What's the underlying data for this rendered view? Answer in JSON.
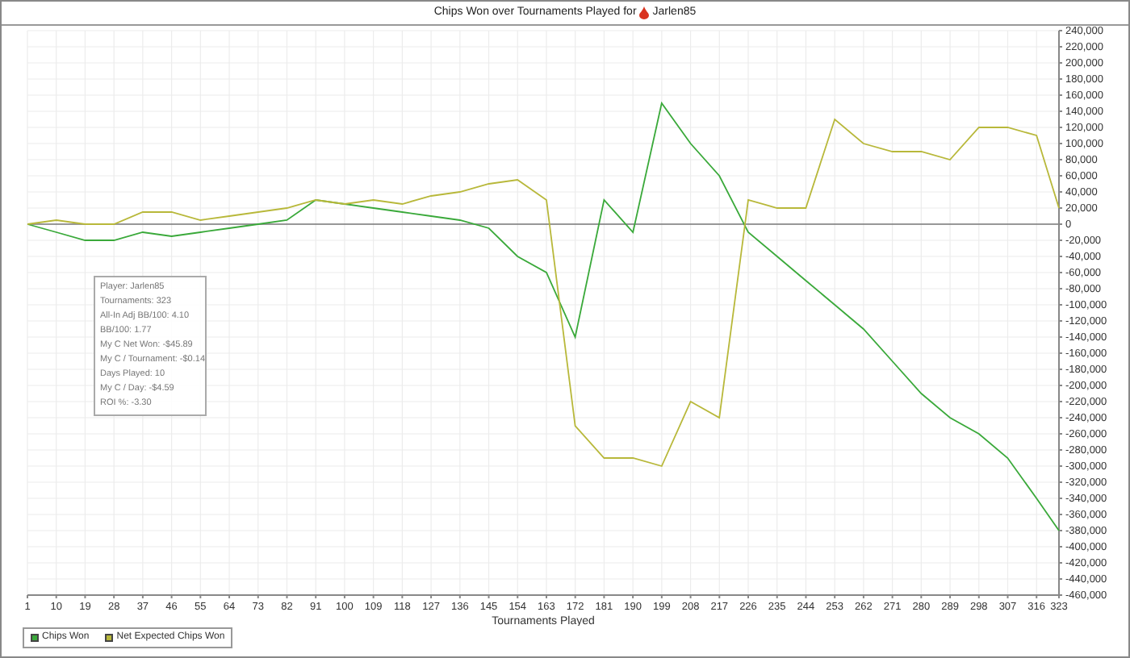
{
  "title": {
    "text": "Chips Won over Tournaments Played for",
    "player": "Jarlen85"
  },
  "stats": [
    "Player: Jarlen85",
    "Tournaments: 323",
    "All-In Adj BB/100: 4.10",
    "BB/100: 1.77",
    "My C Net Won: -$45.89",
    "My C / Tournament: -$0.14",
    "Days Played: 10",
    "My C / Day: -$4.59",
    "ROI %: -3.30"
  ],
  "chart_data": {
    "type": "line",
    "grid": true,
    "xlabel": "Tournaments Played",
    "x": [
      1,
      10,
      19,
      28,
      37,
      46,
      55,
      64,
      73,
      82,
      91,
      100,
      109,
      118,
      127,
      136,
      145,
      154,
      163,
      172,
      181,
      190,
      199,
      208,
      217,
      226,
      235,
      244,
      253,
      262,
      271,
      280,
      289,
      298,
      307,
      316,
      323
    ],
    "xticks": [
      1,
      10,
      19,
      28,
      37,
      46,
      55,
      64,
      73,
      82,
      91,
      100,
      109,
      118,
      127,
      136,
      145,
      154,
      163,
      172,
      181,
      190,
      199,
      208,
      217,
      226,
      235,
      244,
      253,
      262,
      271,
      280,
      289,
      298,
      307,
      316,
      323
    ],
    "xlim": [
      1,
      323
    ],
    "ylim": [
      -460000,
      240000
    ],
    "yticks": [
      {
        "value": 240000,
        "label": "240,000"
      },
      {
        "value": 220000,
        "label": "220,000"
      },
      {
        "value": 200000,
        "label": "200,000"
      },
      {
        "value": 180000,
        "label": "180,000"
      },
      {
        "value": 160000,
        "label": "160,000"
      },
      {
        "value": 140000,
        "label": "140,000"
      },
      {
        "value": 120000,
        "label": "120,000"
      },
      {
        "value": 100000,
        "label": "100,000"
      },
      {
        "value": 80000,
        "label": "80,000"
      },
      {
        "value": 60000,
        "label": "60,000"
      },
      {
        "value": 40000,
        "label": "40,000"
      },
      {
        "value": 20000,
        "label": "20,000"
      },
      {
        "value": 0,
        "label": "0"
      },
      {
        "value": -20000,
        "label": "-20,000"
      },
      {
        "value": -40000,
        "label": "-40,000"
      },
      {
        "value": -60000,
        "label": "-60,000"
      },
      {
        "value": -80000,
        "label": "-80,000"
      },
      {
        "value": -100000,
        "label": "-100,000"
      },
      {
        "value": -120000,
        "label": "-120,000"
      },
      {
        "value": -140000,
        "label": "-140,000"
      },
      {
        "value": -160000,
        "label": "-160,000"
      },
      {
        "value": -180000,
        "label": "-180,000"
      },
      {
        "value": -200000,
        "label": "-200,000"
      },
      {
        "value": -220000,
        "label": "-220,000"
      },
      {
        "value": -240000,
        "label": "-240,000"
      },
      {
        "value": -260000,
        "label": "-260,000"
      },
      {
        "value": -280000,
        "label": "-280,000"
      },
      {
        "value": -300000,
        "label": "-300,000"
      },
      {
        "value": -320000,
        "label": "-320,000"
      },
      {
        "value": -340000,
        "label": "-340,000"
      },
      {
        "value": -360000,
        "label": "-360,000"
      },
      {
        "value": -380000,
        "label": "-380,000"
      },
      {
        "value": -400000,
        "label": "-400,000"
      },
      {
        "value": -420000,
        "label": "-420,000"
      },
      {
        "value": -440000,
        "label": "-440,000"
      },
      {
        "value": -460000,
        "label": "-460,000"
      }
    ],
    "series": [
      {
        "name": "Chips Won",
        "color": "#3aa93a",
        "values": [
          0,
          -10000,
          -20000,
          -20000,
          -10000,
          -15000,
          -10000,
          -5000,
          0,
          5000,
          30000,
          25000,
          20000,
          15000,
          10000,
          5000,
          -5000,
          -40000,
          -60000,
          -140000,
          30000,
          -10000,
          150000,
          100000,
          60000,
          -10000,
          -40000,
          -70000,
          -100000,
          -130000,
          -170000,
          -210000,
          -240000,
          -260000,
          -290000,
          -340000,
          -380000
        ]
      },
      {
        "name": "Net Expected Chips Won",
        "color": "#b8b83a",
        "values": [
          0,
          5000,
          0,
          0,
          15000,
          15000,
          5000,
          10000,
          15000,
          20000,
          30000,
          25000,
          30000,
          25000,
          35000,
          40000,
          50000,
          55000,
          30000,
          -250000,
          -290000,
          -290000,
          -300000,
          -220000,
          -240000,
          30000,
          20000,
          20000,
          130000,
          100000,
          90000,
          90000,
          80000,
          120000,
          120000,
          110000,
          20000
        ]
      }
    ]
  }
}
